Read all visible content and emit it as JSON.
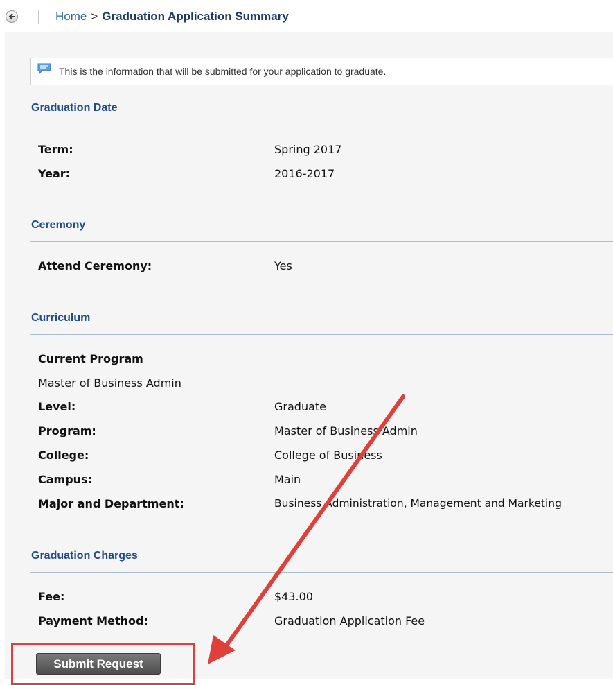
{
  "header": {
    "back_icon": "back-arrow-icon",
    "breadcrumb_home": "Home",
    "breadcrumb_separator": ">",
    "breadcrumb_current": "Graduation Application Summary"
  },
  "info": {
    "icon": "speech-bubble-icon",
    "text": "This is the information that will be submitted for your application to graduate."
  },
  "sections": {
    "graduation_date": {
      "title": "Graduation Date",
      "term_label": "Term:",
      "term_value": "Spring 2017",
      "year_label": "Year:",
      "year_value": "2016-2017"
    },
    "ceremony": {
      "title": "Ceremony",
      "attend_label": "Attend Ceremony:",
      "attend_value": "Yes"
    },
    "curriculum": {
      "title": "Curriculum",
      "current_program_label": "Current Program",
      "current_program_value": "Master of Business Admin",
      "level_label": "Level:",
      "level_value": "Graduate",
      "program_label": "Program:",
      "program_value": "Master of Business Admin",
      "college_label": "College:",
      "college_value": "College of Business",
      "campus_label": "Campus:",
      "campus_value": "Main",
      "major_label": "Major and Department:",
      "major_value": "Business Administration, Management and Marketing"
    },
    "charges": {
      "title": "Graduation Charges",
      "fee_label": "Fee:",
      "fee_value": "$43.00",
      "payment_label": "Payment Method:",
      "payment_value": "Graduation Application Fee"
    }
  },
  "actions": {
    "submit_label": "Submit Request"
  },
  "annotation": {
    "color": "#e0403a"
  }
}
